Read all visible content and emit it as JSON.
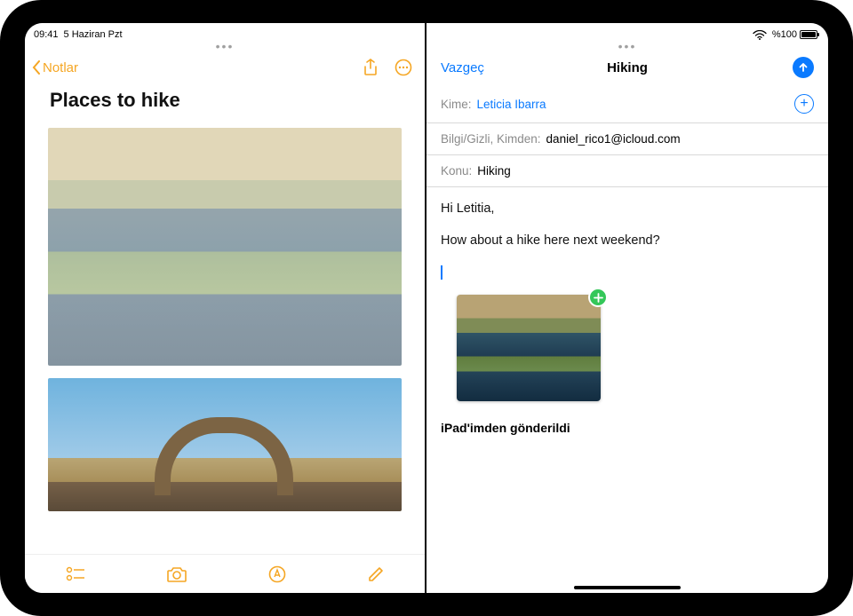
{
  "statusbar": {
    "time": "09:41",
    "date": "5 Haziran Pzt",
    "battery_pct": "%100"
  },
  "notes": {
    "back_label": "Notlar",
    "title": "Places to hike"
  },
  "mail": {
    "cancel": "Vazgeç",
    "title": "Hiking",
    "to_label": "Kime:",
    "to_value": "Leticia Ibarra",
    "cc_from_label": "Bilgi/Gizli, Kimden:",
    "cc_from_value": "daniel_rico1@icloud.com",
    "subject_label": "Konu:",
    "subject_value": "Hiking",
    "body_line1": "Hi Letitia,",
    "body_line2": "How about a hike here next weekend?",
    "signature": "iPad'imden gönderildi"
  }
}
